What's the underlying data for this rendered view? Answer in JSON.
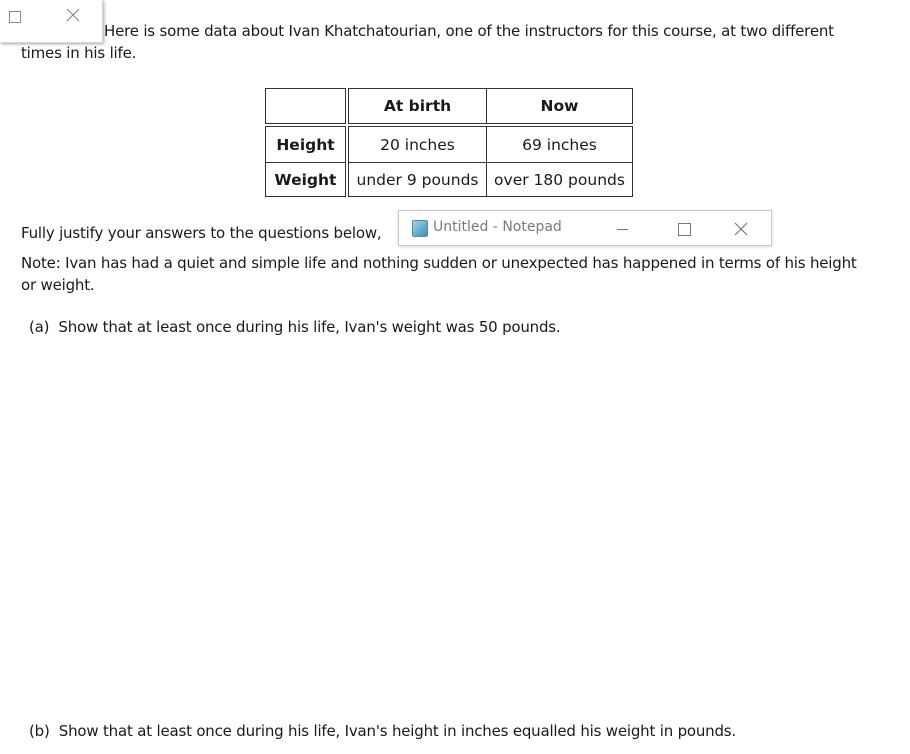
{
  "window_fragment": {
    "maximize_icon": "maximize-icon",
    "close_icon": "close-icon"
  },
  "intro": {
    "line1": "Here is some data about Ivan Khatchatourian, one of the instructors for this course, at two different",
    "line2": "times in his life."
  },
  "table": {
    "headers": [
      "",
      "At birth",
      "Now"
    ],
    "rows": [
      {
        "label": "Height",
        "at_birth": "20 inches",
        "now": "69 inches"
      },
      {
        "label": "Weight",
        "at_birth": "under 9 pounds",
        "now": "over 180 pounds"
      }
    ]
  },
  "instructions": {
    "justify": "Fully justify your answers to the questions below,",
    "note_line1": "Note: Ivan has had a quiet and simple life and nothing sudden or unexpected has happened in terms of his height",
    "note_line2": "or weight."
  },
  "questions": {
    "a": "(a)  Show that at least once during his life, Ivan's weight was 50 pounds.",
    "b": "(b)  Show that at least once during his life, Ivan's height in inches equalled his weight in pounds."
  },
  "notepad": {
    "title": "Untitled - Notepad",
    "app_icon": "notepad-icon",
    "minimize_icon": "minimize-icon",
    "maximize_icon": "maximize-icon",
    "close_icon": "close-icon"
  }
}
